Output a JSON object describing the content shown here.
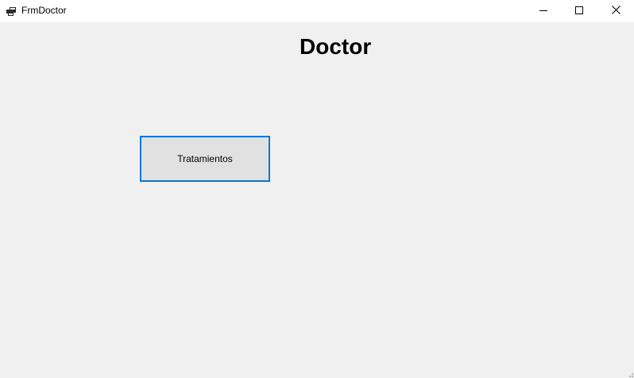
{
  "window": {
    "title": "FrmDoctor",
    "icon": "app-form-icon",
    "controls": {
      "minimize": "minimize-icon",
      "maximize": "maximize-icon",
      "close": "close-icon"
    }
  },
  "form": {
    "heading": "Doctor",
    "buttons": {
      "tratamientos_label": "Tratamientos"
    }
  },
  "colors": {
    "background": "#f0f0f0",
    "titlebar": "#ffffff",
    "button_face": "#e1e1e1",
    "focus_border": "#0078d7"
  }
}
